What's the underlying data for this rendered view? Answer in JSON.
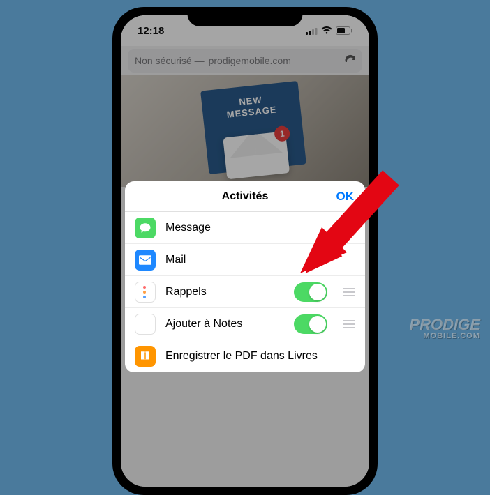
{
  "status": {
    "time": "12:18"
  },
  "url": {
    "prefix": "Non sécurisé —",
    "domain": "prodigemobile.com"
  },
  "hero": {
    "card_title": "NEW\nMESSAGE",
    "badge": "1"
  },
  "sheet": {
    "title": "Activités",
    "ok": "OK",
    "rows": [
      {
        "label": "Message",
        "toggle": false,
        "handle": false
      },
      {
        "label": "Mail",
        "toggle": false,
        "handle": false
      },
      {
        "label": "Rappels",
        "toggle": true,
        "handle": true
      },
      {
        "label": "Ajouter à Notes",
        "toggle": true,
        "handle": true
      },
      {
        "label": "Enregistrer le PDF dans Livres",
        "toggle": false,
        "handle": false
      }
    ]
  },
  "watermark": {
    "brand": "PRODIGE",
    "sub": "MOBILE.COM"
  }
}
